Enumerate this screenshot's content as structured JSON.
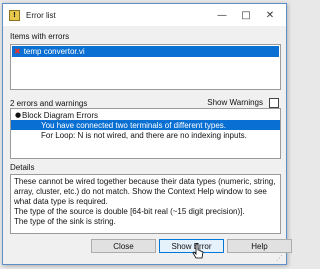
{
  "window": {
    "title": "Error list"
  },
  "titlebar_buttons": {
    "minimize": "—",
    "maximize": "□",
    "close": "✕"
  },
  "items": {
    "label": "Items with errors",
    "entries": [
      {
        "name": "temp convertor.vi",
        "icon": "error-x-icon"
      }
    ]
  },
  "errors": {
    "count_label": "2 errors and warnings",
    "show_warnings_label": "Show Warnings",
    "show_warnings_checked": false,
    "group": "Block Diagram Errors",
    "rows": [
      "You have connected two terminals of different types.",
      "For Loop: N is not wired, and there are no indexing inputs."
    ]
  },
  "details": {
    "label": "Details",
    "text": "These cannot be wired together because their data types (numeric, string, array, cluster, etc.) do not match. Show the Context Help window to see what data type is required.\nThe type of the source is double [64-bit real (~15 digit precision)].\nThe type of the sink is string."
  },
  "buttons": {
    "close": "Close",
    "show_error": "Show Error",
    "help": "Help"
  },
  "colors": {
    "selection": "#0a6fd2",
    "window_border": "#5e8fc8",
    "error_icon": "#e4322b"
  }
}
